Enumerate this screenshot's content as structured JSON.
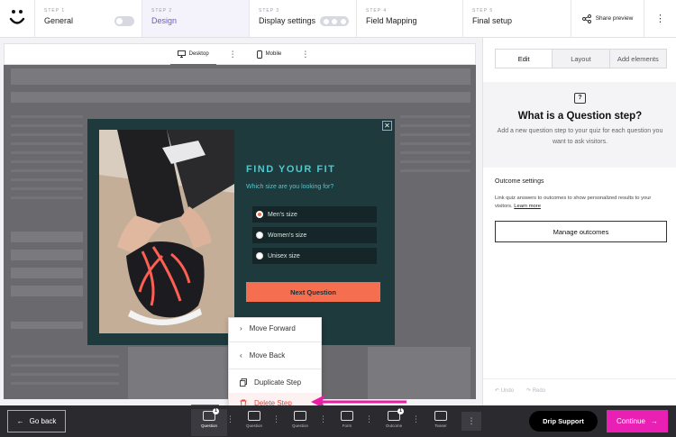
{
  "steps": [
    {
      "num": "STEP 1",
      "label": "General"
    },
    {
      "num": "STEP 2",
      "label": "Design"
    },
    {
      "num": "STEP 3",
      "label": "Display settings"
    },
    {
      "num": "STEP 4",
      "label": "Field Mapping"
    },
    {
      "num": "STEP 5",
      "label": "Final setup"
    }
  ],
  "share_preview": "Share preview",
  "devices": {
    "desktop": "Desktop",
    "mobile": "Mobile"
  },
  "popup": {
    "title": "FIND YOUR FIT",
    "subtitle": "Which size are you looking for?",
    "options": [
      "Men's size",
      "Women's size",
      "Unisex size"
    ],
    "next_button": "Next Question",
    "close": "✕"
  },
  "context_menu": {
    "items": [
      "Move Forward",
      "Move Back",
      "Duplicate Step",
      "Delete Step"
    ]
  },
  "sidebar": {
    "tabs": [
      "Edit",
      "Layout",
      "Add elements"
    ],
    "heading": "What is a Question step?",
    "description": "Add a new question step to your quiz for each question you want to ask visitors.",
    "outcome_title": "Outcome settings",
    "outcome_desc": "Link quiz answers to outcomes to show personalized results to your visitors.",
    "learn_more": "Learn more",
    "manage_button": "Manage outcomes",
    "undo": "Undo",
    "redo": "Redo"
  },
  "bottom": {
    "go_back": "Go back",
    "tiles": [
      {
        "label": "Question",
        "badge": "1"
      },
      {
        "label": "Question",
        "badge": ""
      },
      {
        "label": "Question",
        "badge": ""
      },
      {
        "label": "Form",
        "badge": ""
      },
      {
        "label": "Outcome",
        "badge": "1"
      },
      {
        "label": "Teaser",
        "badge": ""
      }
    ],
    "drip_support": "Drip Support",
    "continue": "Continue"
  },
  "colors": {
    "accent": "#e91ea5",
    "active_step": "#6e56cf",
    "popup_bg": "#1e3a3d",
    "popup_text": "#52c7cc",
    "cta": "#f46e4f",
    "danger": "#e2463b"
  }
}
